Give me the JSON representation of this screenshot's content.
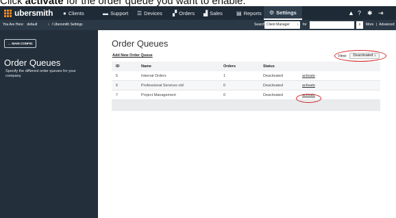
{
  "caption": {
    "prefix": "Click ",
    "bold": "activate",
    "suffix": " for the order queue you want to enable."
  },
  "topnav": {
    "brand": "ubersmith",
    "items": [
      {
        "label": "Clients",
        "icon": "user-icon"
      },
      {
        "label": "Support",
        "icon": "inbox-icon"
      },
      {
        "label": "Devices",
        "icon": "server-icon"
      },
      {
        "label": "Orders",
        "icon": "orders-icon"
      },
      {
        "label": "Sales",
        "icon": "bar-chart-icon"
      },
      {
        "label": "Reports",
        "icon": "report-icon"
      },
      {
        "label": "Settings",
        "icon": "gear-icon"
      }
    ],
    "right_icons": [
      "bell-icon",
      "help-icon",
      "gear-icon",
      "logout-icon"
    ],
    "brand_color": "#f08a24",
    "bar_color": "#1e2a36"
  },
  "subbar": {
    "you_are_here": "You Are Here:",
    "location": "default",
    "location_arrow": "↕",
    "path": "/ Ubersmith Settings",
    "search_label": "Search",
    "search_scope": "Client Manager",
    "for_label": "for",
    "search_value": "",
    "more": "More",
    "separator": "|",
    "advanced": "Advanced"
  },
  "sidebar": {
    "back_button": "← MAIN CONFIG",
    "title": "Order Queues",
    "description": "Specify the different order queues for your company."
  },
  "main": {
    "title": "Order Queues",
    "add_link": "Add New Order Queue",
    "view_label": "View:",
    "view_value": "Deactivated",
    "view_arrow": "↕",
    "columns": [
      "ID",
      "Name",
      "Orders",
      "Status"
    ],
    "rows": [
      {
        "id": "5",
        "name": "Internal Orders",
        "orders": "1",
        "status": "Deactivated",
        "action": "activate"
      },
      {
        "id": "6",
        "name": "Professional Services old",
        "orders": "0",
        "status": "Deactivated",
        "action": "activate"
      },
      {
        "id": "7",
        "name": "Project Management",
        "orders": "0",
        "status": "Deactivated",
        "action": "activate"
      }
    ],
    "highlight_color": "#d32020"
  }
}
